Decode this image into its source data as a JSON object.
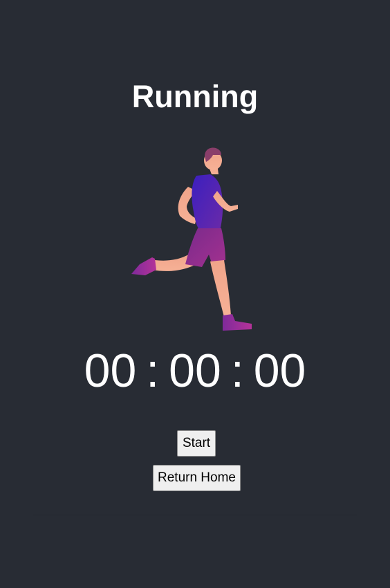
{
  "header": {
    "title": "Running"
  },
  "timer": {
    "hours": "00",
    "minutes": "00",
    "seconds": "00",
    "separator": ":"
  },
  "buttons": {
    "start_label": "Start",
    "home_label": "Return Home"
  },
  "illustration": {
    "icon": "runner-icon"
  },
  "colors": {
    "background": "#282c34",
    "text": "#ffffff",
    "button_bg": "#efefef",
    "runner_top": "#4a1fb8",
    "runner_shorts": "#8e2a8f",
    "runner_skin": "#f3a589",
    "runner_shoes": "#a92e9c"
  }
}
